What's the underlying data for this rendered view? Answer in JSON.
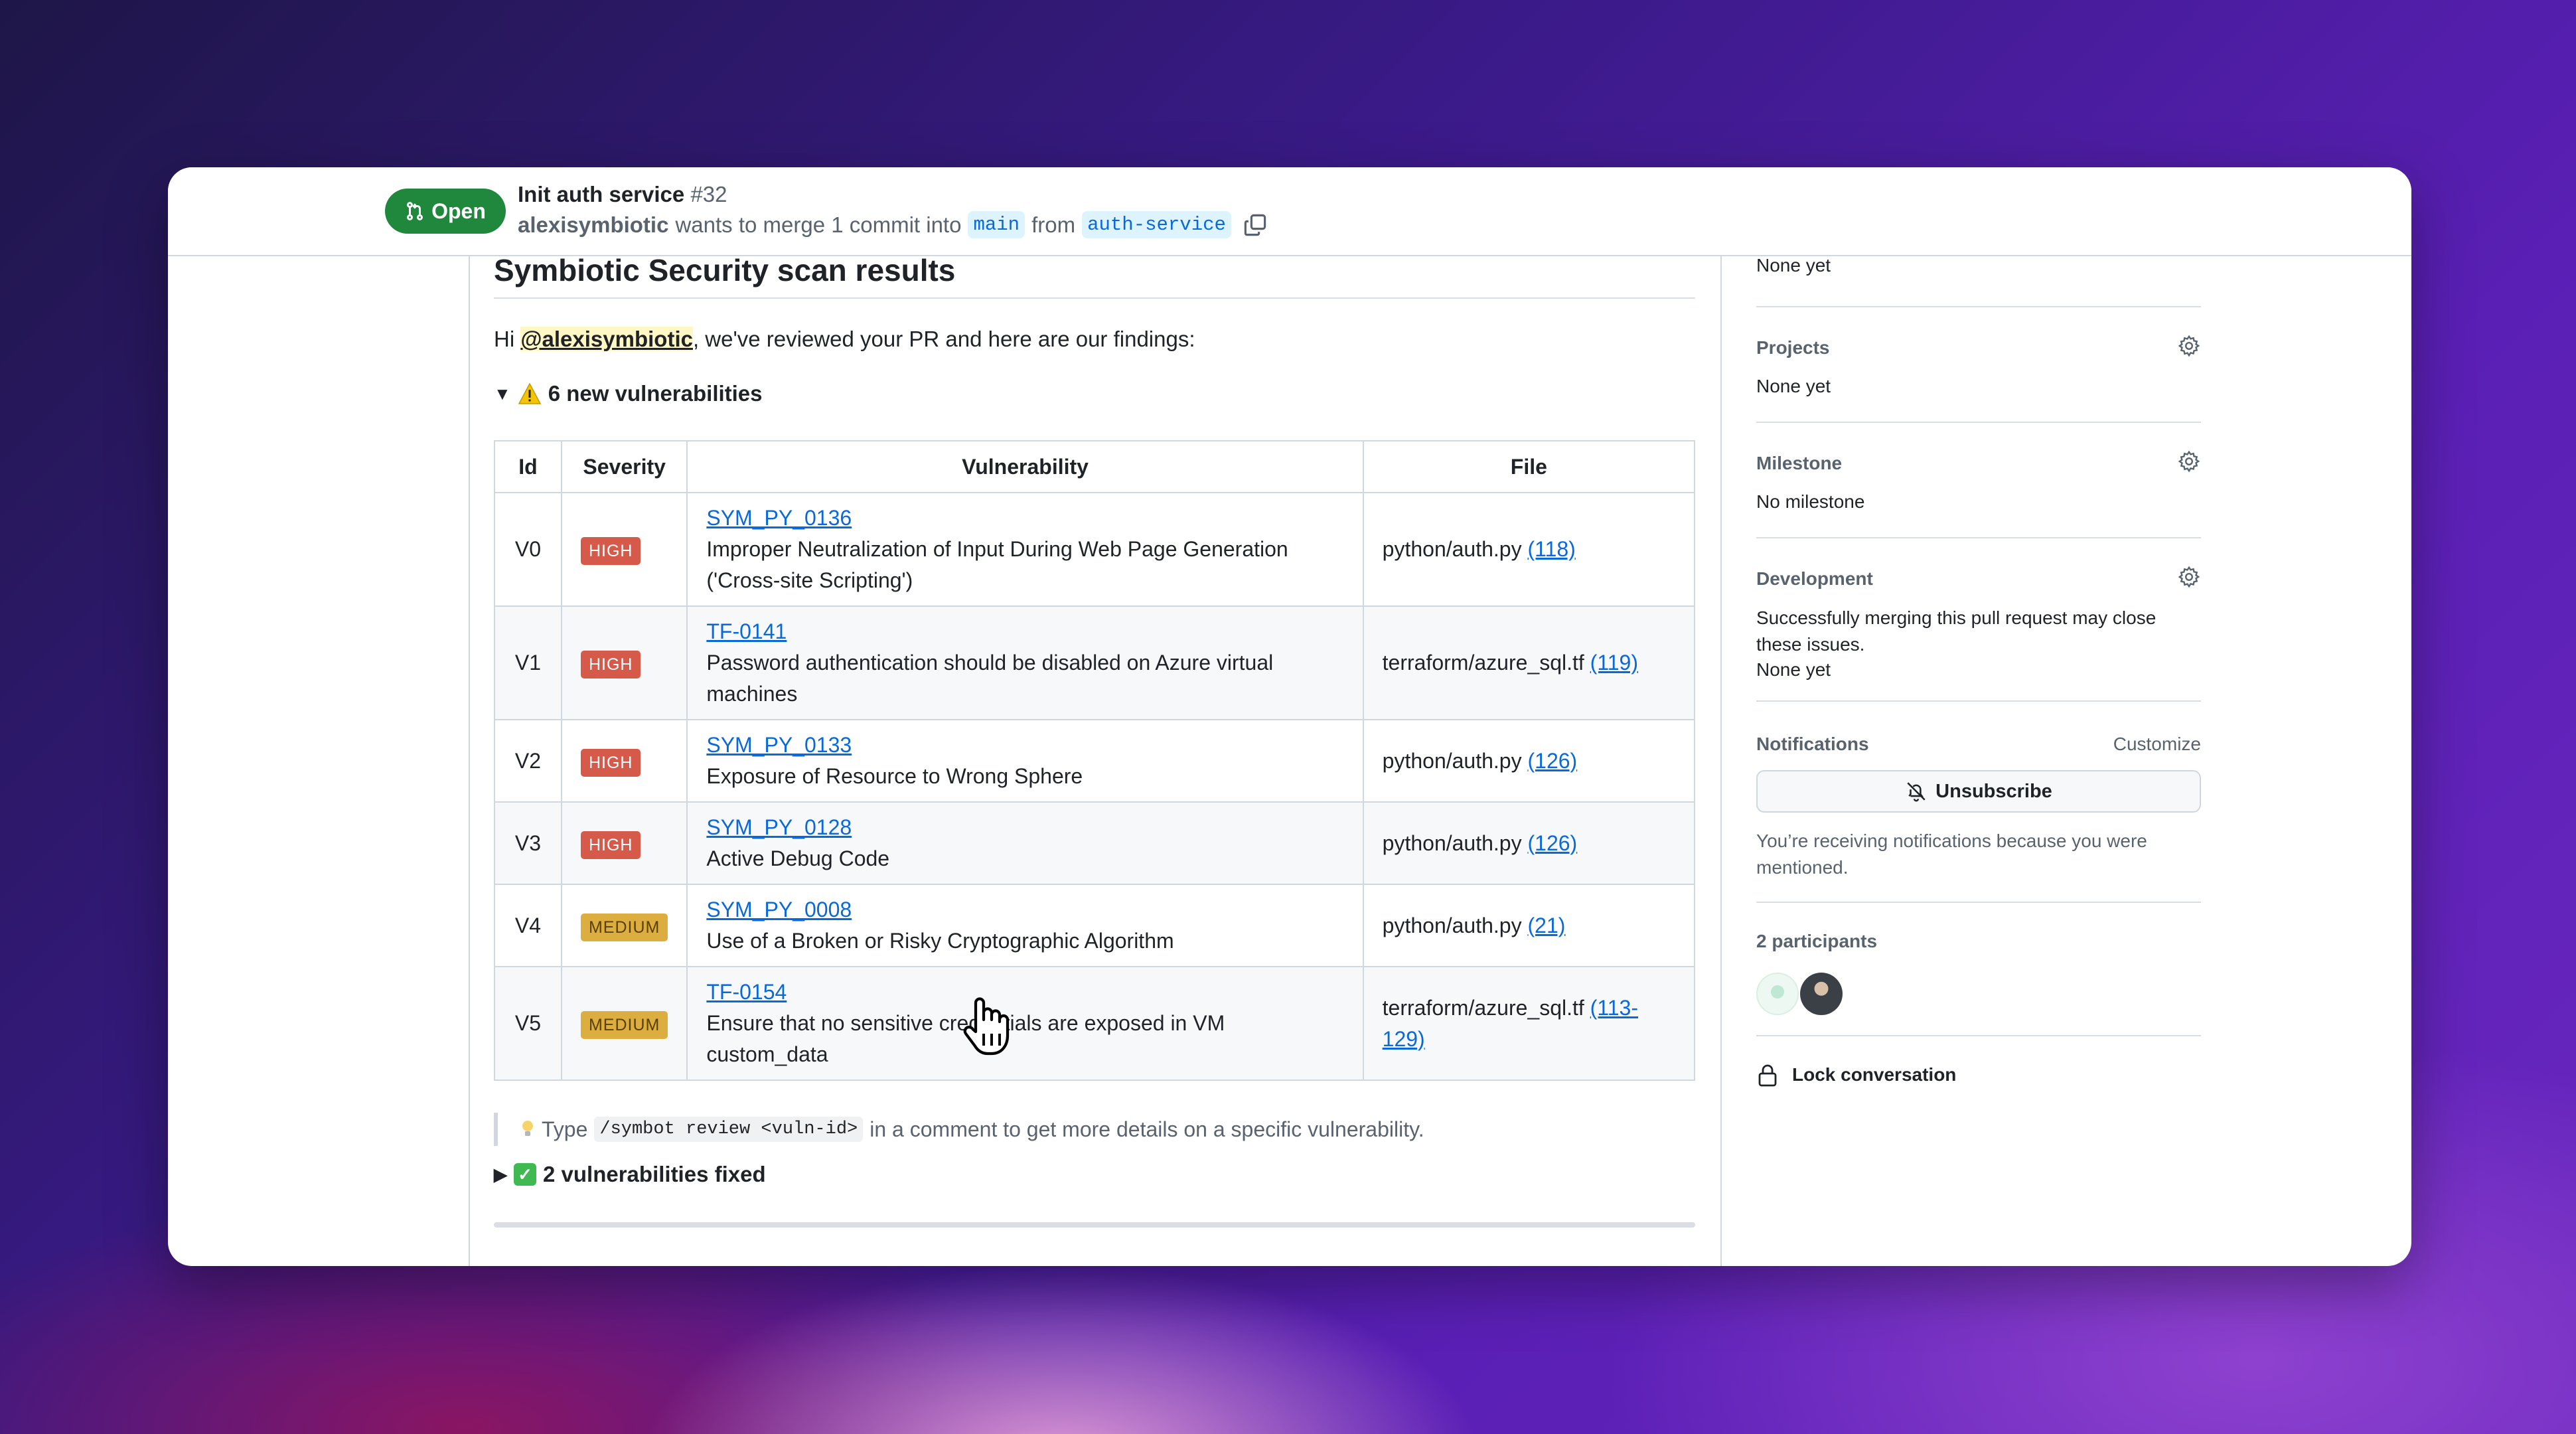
{
  "header": {
    "state": "Open",
    "title": "Init auth service",
    "number": "#32",
    "author": "alexisymbiotic",
    "merge_text": "wants to merge 1 commit into",
    "base_branch": "main",
    "from_text": "from",
    "head_branch": "auth-service"
  },
  "comment": {
    "title": "Symbiotic Security scan results",
    "greeting_pre": "Hi ",
    "mention": "@alexisymbiotic",
    "greeting_post": ", we've reviewed your PR and here are our findings:",
    "new_vulns_summary": "6 new vulnerabilities",
    "table": {
      "headers": [
        "Id",
        "Severity",
        "Vulnerability",
        "File"
      ],
      "rows": [
        {
          "id": "V0",
          "severity": "HIGH",
          "vuln_id": "SYM_PY_0136",
          "description": "Improper Neutralization of Input During Web Page Generation ('Cross-site Scripting')",
          "file": "python/auth.py",
          "lines": "(118)"
        },
        {
          "id": "V1",
          "severity": "HIGH",
          "vuln_id": "TF-0141",
          "description": "Password authentication should be disabled on Azure virtual machines",
          "file": "terraform/azure_sql.tf",
          "lines": "(119)"
        },
        {
          "id": "V2",
          "severity": "HIGH",
          "vuln_id": "SYM_PY_0133",
          "description": "Exposure of Resource to Wrong Sphere",
          "file": "python/auth.py",
          "lines": "(126)"
        },
        {
          "id": "V3",
          "severity": "HIGH",
          "vuln_id": "SYM_PY_0128",
          "description": "Active Debug Code",
          "file": "python/auth.py",
          "lines": "(126)"
        },
        {
          "id": "V4",
          "severity": "MEDIUM",
          "vuln_id": "SYM_PY_0008",
          "description": "Use of a Broken or Risky Cryptographic Algorithm",
          "file": "python/auth.py",
          "lines": "(21)"
        },
        {
          "id": "V5",
          "severity": "MEDIUM",
          "vuln_id": "TF-0154",
          "description": "Ensure that no sensitive credentials are exposed in VM custom_data",
          "file": "terraform/azure_sql.tf",
          "lines": "(113-129)"
        }
      ]
    },
    "tip_pre": "Type",
    "tip_code": "/symbot review <vuln-id>",
    "tip_post": "in a comment to get more details on a specific vulnerability.",
    "fixed_summary": "2 vulnerabilities fixed"
  },
  "sidebar": {
    "top_value": "None yet",
    "projects": {
      "label": "Projects",
      "value": "None yet"
    },
    "milestone": {
      "label": "Milestone",
      "value": "No milestone"
    },
    "development": {
      "label": "Development",
      "description": "Successfully merging this pull request may close these issues.",
      "value": "None yet"
    },
    "notifications": {
      "label": "Notifications",
      "customize": "Customize",
      "unsubscribe": "Unsubscribe",
      "reason": "You’re receiving notifications because you were mentioned."
    },
    "participants": {
      "label": "2 participants"
    },
    "lock": "Lock conversation"
  },
  "colors": {
    "open_green": "#1f883d",
    "link_blue": "#0969da",
    "high": "#d65a4a",
    "medium": "#dbae3f"
  },
  "icons": [
    "git-pull-request-icon",
    "copy-icon",
    "warning-icon",
    "gear-icon",
    "bell-slash-icon",
    "lock-icon",
    "check-icon",
    "lightbulb-icon",
    "hand-cursor-icon"
  ]
}
